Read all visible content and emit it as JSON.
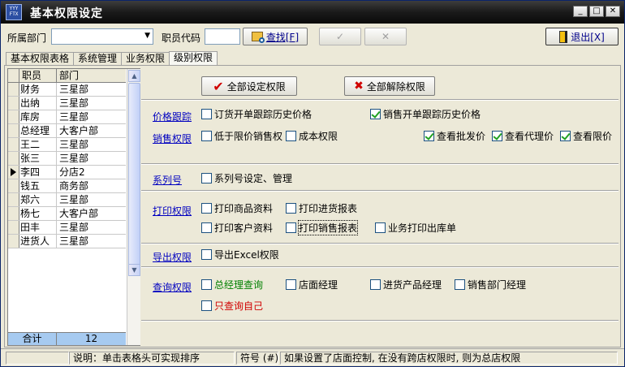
{
  "window": {
    "title": "基本权限设定",
    "icon_text": "YYY\nFTX"
  },
  "toolbar": {
    "dept_label": "所属部门",
    "dept_value": "",
    "code_label": "职员代码",
    "code_value": "",
    "find_label": "查找[F]",
    "ok_glyph": "✓",
    "cancel_glyph": "✕",
    "exit_label": "退出[X]"
  },
  "tabs": [
    "基本权限表格",
    "系统管理",
    "业务权限",
    "级别权限"
  ],
  "active_tab": 3,
  "grid": {
    "headers": [
      "职员",
      "部门"
    ],
    "rows": [
      {
        "name": "财务",
        "dept": "三星部"
      },
      {
        "name": "出纳",
        "dept": "三星部"
      },
      {
        "name": "库房",
        "dept": "三星部"
      },
      {
        "name": "总经理",
        "dept": "大客户部"
      },
      {
        "name": "王二",
        "dept": "三星部"
      },
      {
        "name": "张三",
        "dept": "三星部"
      },
      {
        "name": "李四",
        "dept": "分店2"
      },
      {
        "name": "钱五",
        "dept": "商务部"
      },
      {
        "name": "郑六",
        "dept": "三星部"
      },
      {
        "name": "杨七",
        "dept": "大客户部"
      },
      {
        "name": "田丰",
        "dept": "三星部"
      },
      {
        "name": "进货人",
        "dept": "三星部"
      }
    ],
    "selected_index": 6,
    "total_label": "合计",
    "total_value": "12"
  },
  "actions": {
    "set_all": "全部设定权限",
    "clear_all": "全部解除权限"
  },
  "sections": {
    "price_track": {
      "title": "价格跟踪",
      "items": [
        {
          "label": "订货开单跟踪历史价格",
          "checked": false
        },
        {
          "label": "销售开单跟踪历史价格",
          "checked": true
        }
      ]
    },
    "sales": {
      "title": "销售权限",
      "items": [
        {
          "label": "低于限价销售权",
          "checked": false
        },
        {
          "label": "成本权限",
          "checked": false
        },
        {
          "label": "查看批发价",
          "checked": true
        },
        {
          "label": "查看代理价",
          "checked": true
        },
        {
          "label": "查看限价",
          "checked": true
        }
      ]
    },
    "serial": {
      "title": "系列号",
      "items": [
        {
          "label": "系列号设定、管理",
          "checked": false
        }
      ]
    },
    "print": {
      "title": "打印权限",
      "items": [
        {
          "label": "打印商品资料",
          "checked": false
        },
        {
          "label": "打印进货报表",
          "checked": false
        },
        {
          "label": "打印客户资料",
          "checked": false
        },
        {
          "label": "打印销售报表",
          "checked": false
        },
        {
          "label": "业务打印出库单",
          "checked": false
        }
      ]
    },
    "export": {
      "title": "导出权限",
      "items": [
        {
          "label": "导出Excel权限",
          "checked": false
        }
      ]
    },
    "query": {
      "title": "查询权限",
      "items": [
        {
          "label": "总经理查询",
          "checked": false
        },
        {
          "label": "店面经理",
          "checked": false
        },
        {
          "label": "进货产品经理",
          "checked": false
        },
        {
          "label": "销售部门经理",
          "checked": false
        },
        {
          "label": "只查询自己",
          "checked": false
        }
      ]
    }
  },
  "status": {
    "hint": "说明：单击表格头可实现排序",
    "symbol": "符号 (#)",
    "note": "如果设置了店面控制, 在没有跨店权限时, 则为总店权限"
  },
  "colors": {
    "link": "#0000c0",
    "check": "#21a121",
    "total_bg": "#a6caf0",
    "green_text": "#008000",
    "red_text": "#d00000"
  }
}
